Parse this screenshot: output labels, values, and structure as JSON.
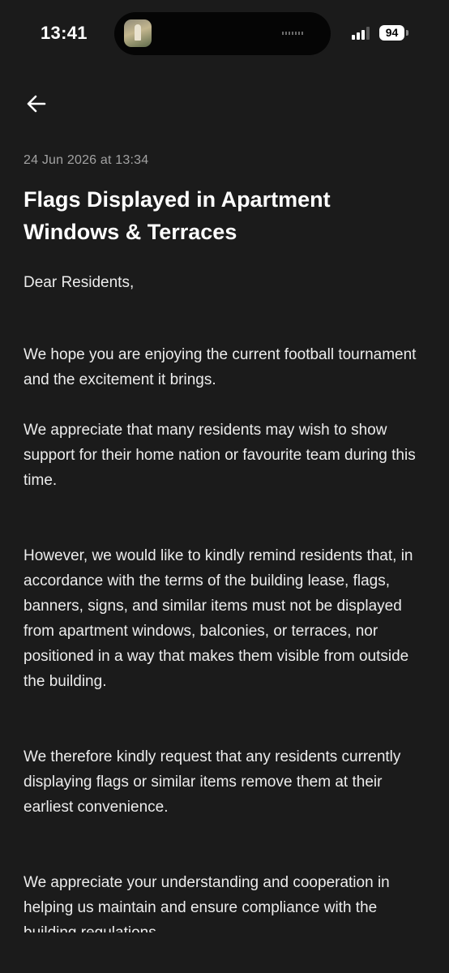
{
  "status_bar": {
    "time": "13:41",
    "battery": "94"
  },
  "notice": {
    "date": "24 Jun 2026 at 13:34",
    "title": "Flags Displayed in Apartment Windows & Terraces",
    "greeting": "Dear Residents,",
    "paragraphs": [
      "We hope you are enjoying the current football tournament and the excitement it brings.",
      "We appreciate that many residents may wish to show support for their home nation or favourite team during this time.",
      "However, we would like to kindly remind residents that, in accordance with the terms of the building lease, flags, banners, signs, and similar items must not be displayed from apartment windows, balconies, or terraces, nor positioned in a way that makes them visible from outside the building.",
      "We therefore kindly request that any residents currently displaying flags or similar items remove them at their earliest convenience.",
      "We appreciate your understanding and cooperation in helping us maintain and ensure compliance with the building regulations."
    ]
  },
  "icons": {
    "back": "arrow-left-icon",
    "signal": "cellular-signal-icon",
    "battery": "battery-icon"
  },
  "colors": {
    "background": "#1b1b1b",
    "text": "#ececec",
    "muted": "#a2a2a2"
  }
}
